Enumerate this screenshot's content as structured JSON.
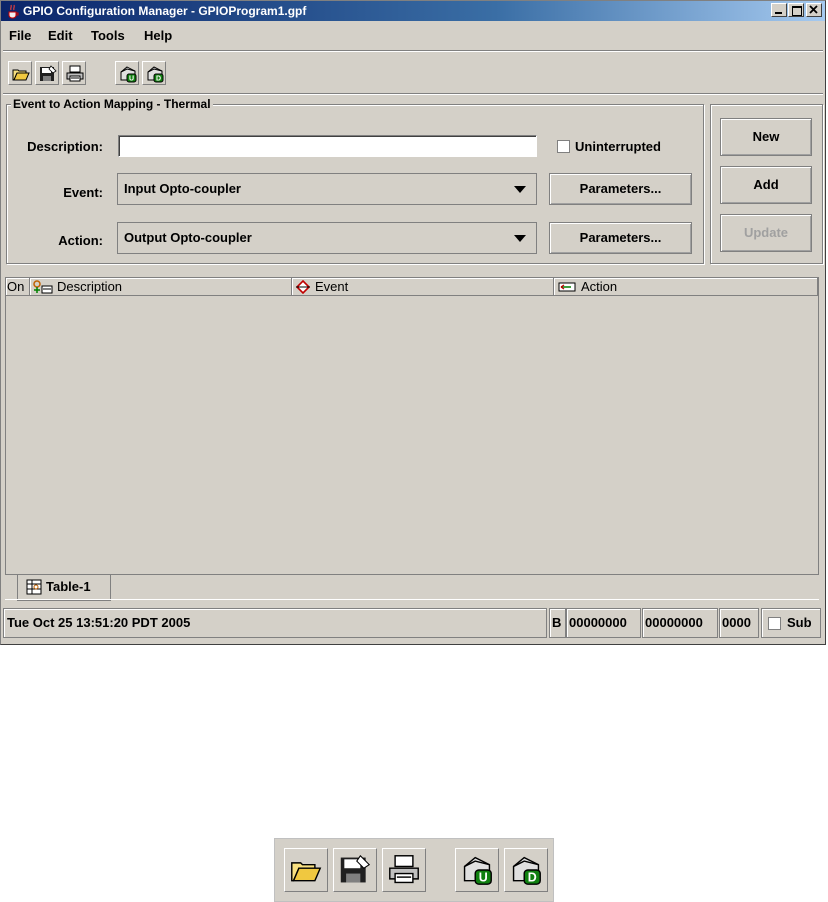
{
  "window": {
    "title": "GPIO Configuration Manager - GPIOProgram1.gpf"
  },
  "menu": {
    "items": [
      {
        "label": "File",
        "name": "file"
      },
      {
        "label": "Edit",
        "name": "edit"
      },
      {
        "label": "Tools",
        "name": "tools"
      },
      {
        "label": "Help",
        "name": "help"
      }
    ]
  },
  "toolbar": {
    "icons": [
      "open-folder-icon",
      "save-icon",
      "print-icon",
      "upload-icon",
      "download-icon"
    ]
  },
  "mapping": {
    "group_title": "Event to Action Mapping - Thermal",
    "description_label": "Description:",
    "description_value": "",
    "uninterrupted_label": "Uninterrupted",
    "uninterrupted_checked": false,
    "event_label": "Event:",
    "event_value": "Input Opto-coupler",
    "action_label": "Action:",
    "action_value": "Output Opto-coupler",
    "parameters_label": "Parameters...",
    "new_label": "New",
    "add_label": "Add",
    "update_label": "Update"
  },
  "table": {
    "columns": [
      "On",
      "Description",
      "Event",
      "Action"
    ],
    "rows": [],
    "tab_label": "Table-1"
  },
  "status": {
    "datetime": "Tue Oct 25 13:51:20 PDT 2005",
    "mode": "B",
    "value1": "00000000",
    "value2": "00000000",
    "value3": "0000",
    "sub_label": "Sub",
    "sub_checked": false
  },
  "colors": {
    "titlebar_start": "#0a246a",
    "titlebar_end": "#a6caf0",
    "window_bg": "#d4d0c8",
    "disabled_text": "#a0a0a0"
  }
}
